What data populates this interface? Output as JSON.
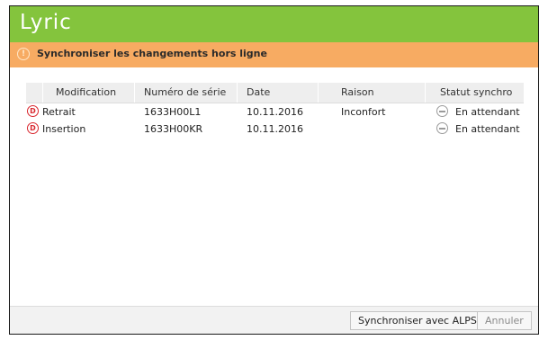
{
  "app": {
    "logo": "Lyric"
  },
  "banner": {
    "message": "Synchroniser les changements hors ligne"
  },
  "table": {
    "headers": [
      "Modification",
      "Numéro de série",
      "Date",
      "Raison",
      "Statut synchro"
    ],
    "rows": [
      {
        "type_badge": "D",
        "modification": "Retrait",
        "serial": "1633H00L1",
        "date": "10.11.2016",
        "reason": "Inconfort",
        "status": "En attendant"
      },
      {
        "type_badge": "D",
        "modification": "Insertion",
        "serial": "1633H00KR",
        "date": "10.11.2016",
        "reason": "",
        "status": "En attendant"
      }
    ]
  },
  "footer": {
    "sync_label": "Synchroniser avec ALPS",
    "cancel_label": "Annuler"
  },
  "colors": {
    "title_bar": "#84c43d",
    "banner": "#f7ab62",
    "badge_red": "#d9272e"
  },
  "icons": {
    "banner": "warning-icon",
    "row_badge": "delete-badge-icon",
    "status": "pending-icon"
  }
}
